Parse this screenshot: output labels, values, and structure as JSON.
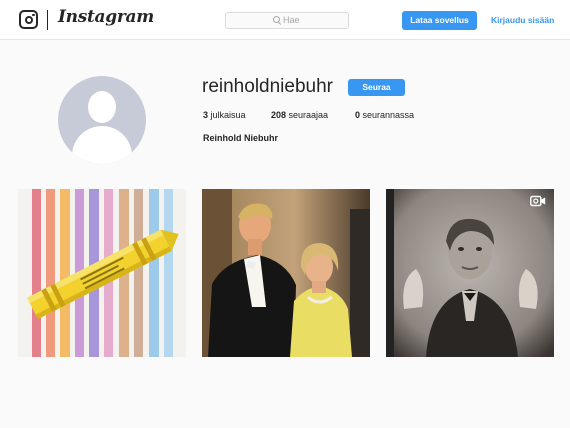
{
  "header": {
    "brand": "Instagram",
    "search_placeholder": "Hae",
    "download_button": "Lataa sovellus",
    "login_link": "Kirjaudu sisään"
  },
  "profile": {
    "username": "reinholdniebuhr",
    "follow_button": "Seuraa",
    "full_name": "Reinhold Niebuhr",
    "stats": {
      "posts_count": "3",
      "posts_label": " julkaisua",
      "followers_count": "208",
      "followers_label": " seuraajaa",
      "following_count": "0",
      "following_label": " seurannassa"
    }
  },
  "posts": [
    {
      "subject": "crayon-on-colored-stripes",
      "media": "photo"
    },
    {
      "subject": "man-and-woman-at-formal-event",
      "media": "photo"
    },
    {
      "subject": "black-and-white-man-gesturing",
      "media": "video"
    }
  ],
  "colors": {
    "accent": "#3897f0",
    "text": "#262626",
    "background": "#fafafa",
    "avatar_placeholder": "#c7cbd8"
  }
}
